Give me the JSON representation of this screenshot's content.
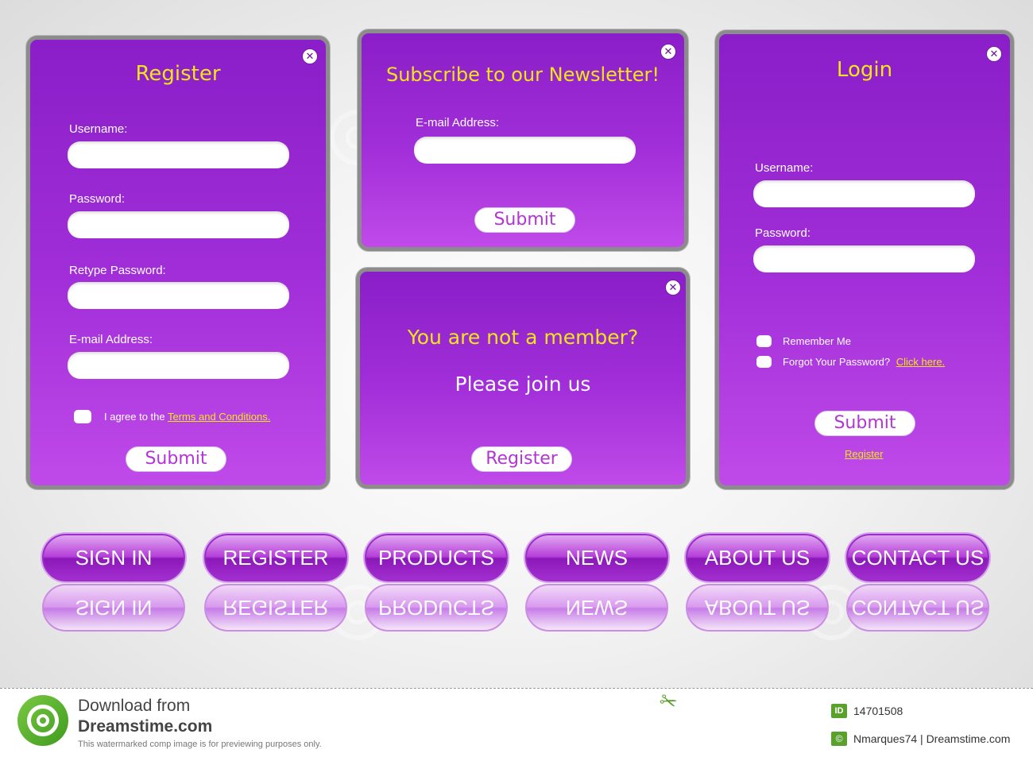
{
  "register": {
    "title": "Register",
    "username_label": "Username:",
    "password_label": "Password:",
    "retype_label": "Retype Password:",
    "email_label": "E-mail Address:",
    "agree_text": "I agree to the ",
    "terms_link": "Terms and Conditions.",
    "submit_label": "Submit",
    "close_glyph": "✕"
  },
  "newsletter": {
    "title": "Subscribe to our Newsletter!",
    "email_label": "E-mail Address:",
    "submit_label": "Submit",
    "close_glyph": "✕"
  },
  "member": {
    "title": "You are not a member?",
    "subtitle": "Please join us",
    "register_label": "Register",
    "close_glyph": "✕"
  },
  "login": {
    "title": "Login",
    "username_label": "Username:",
    "password_label": "Password:",
    "remember_label": "Remember Me",
    "forgot_label": "Forgot Your Password?",
    "click_here": "Click here.",
    "submit_label": "Submit",
    "register_link": "Register",
    "close_glyph": "✕"
  },
  "nav": {
    "sign_in": "SIGN IN",
    "register": "REGISTER",
    "products": "PRODUCTS",
    "news": "NEWS",
    "about_us": "ABOUT US",
    "contact_us": "CONTACT US"
  },
  "footer": {
    "download_from": "Download from",
    "site": "Dreamstime.com",
    "notice": "This watermarked comp image is for previewing purposes only.",
    "id_badge": "ID",
    "image_id": "14701508",
    "copyright_badge": "©",
    "credit": "Nmarques74 | Dreamstime.com"
  },
  "colors": {
    "panel_purple": "#a22fd9",
    "title_yellow": "#f2e51a",
    "button_text": "#b434d8",
    "frame_gray": "#8c8c8c"
  }
}
